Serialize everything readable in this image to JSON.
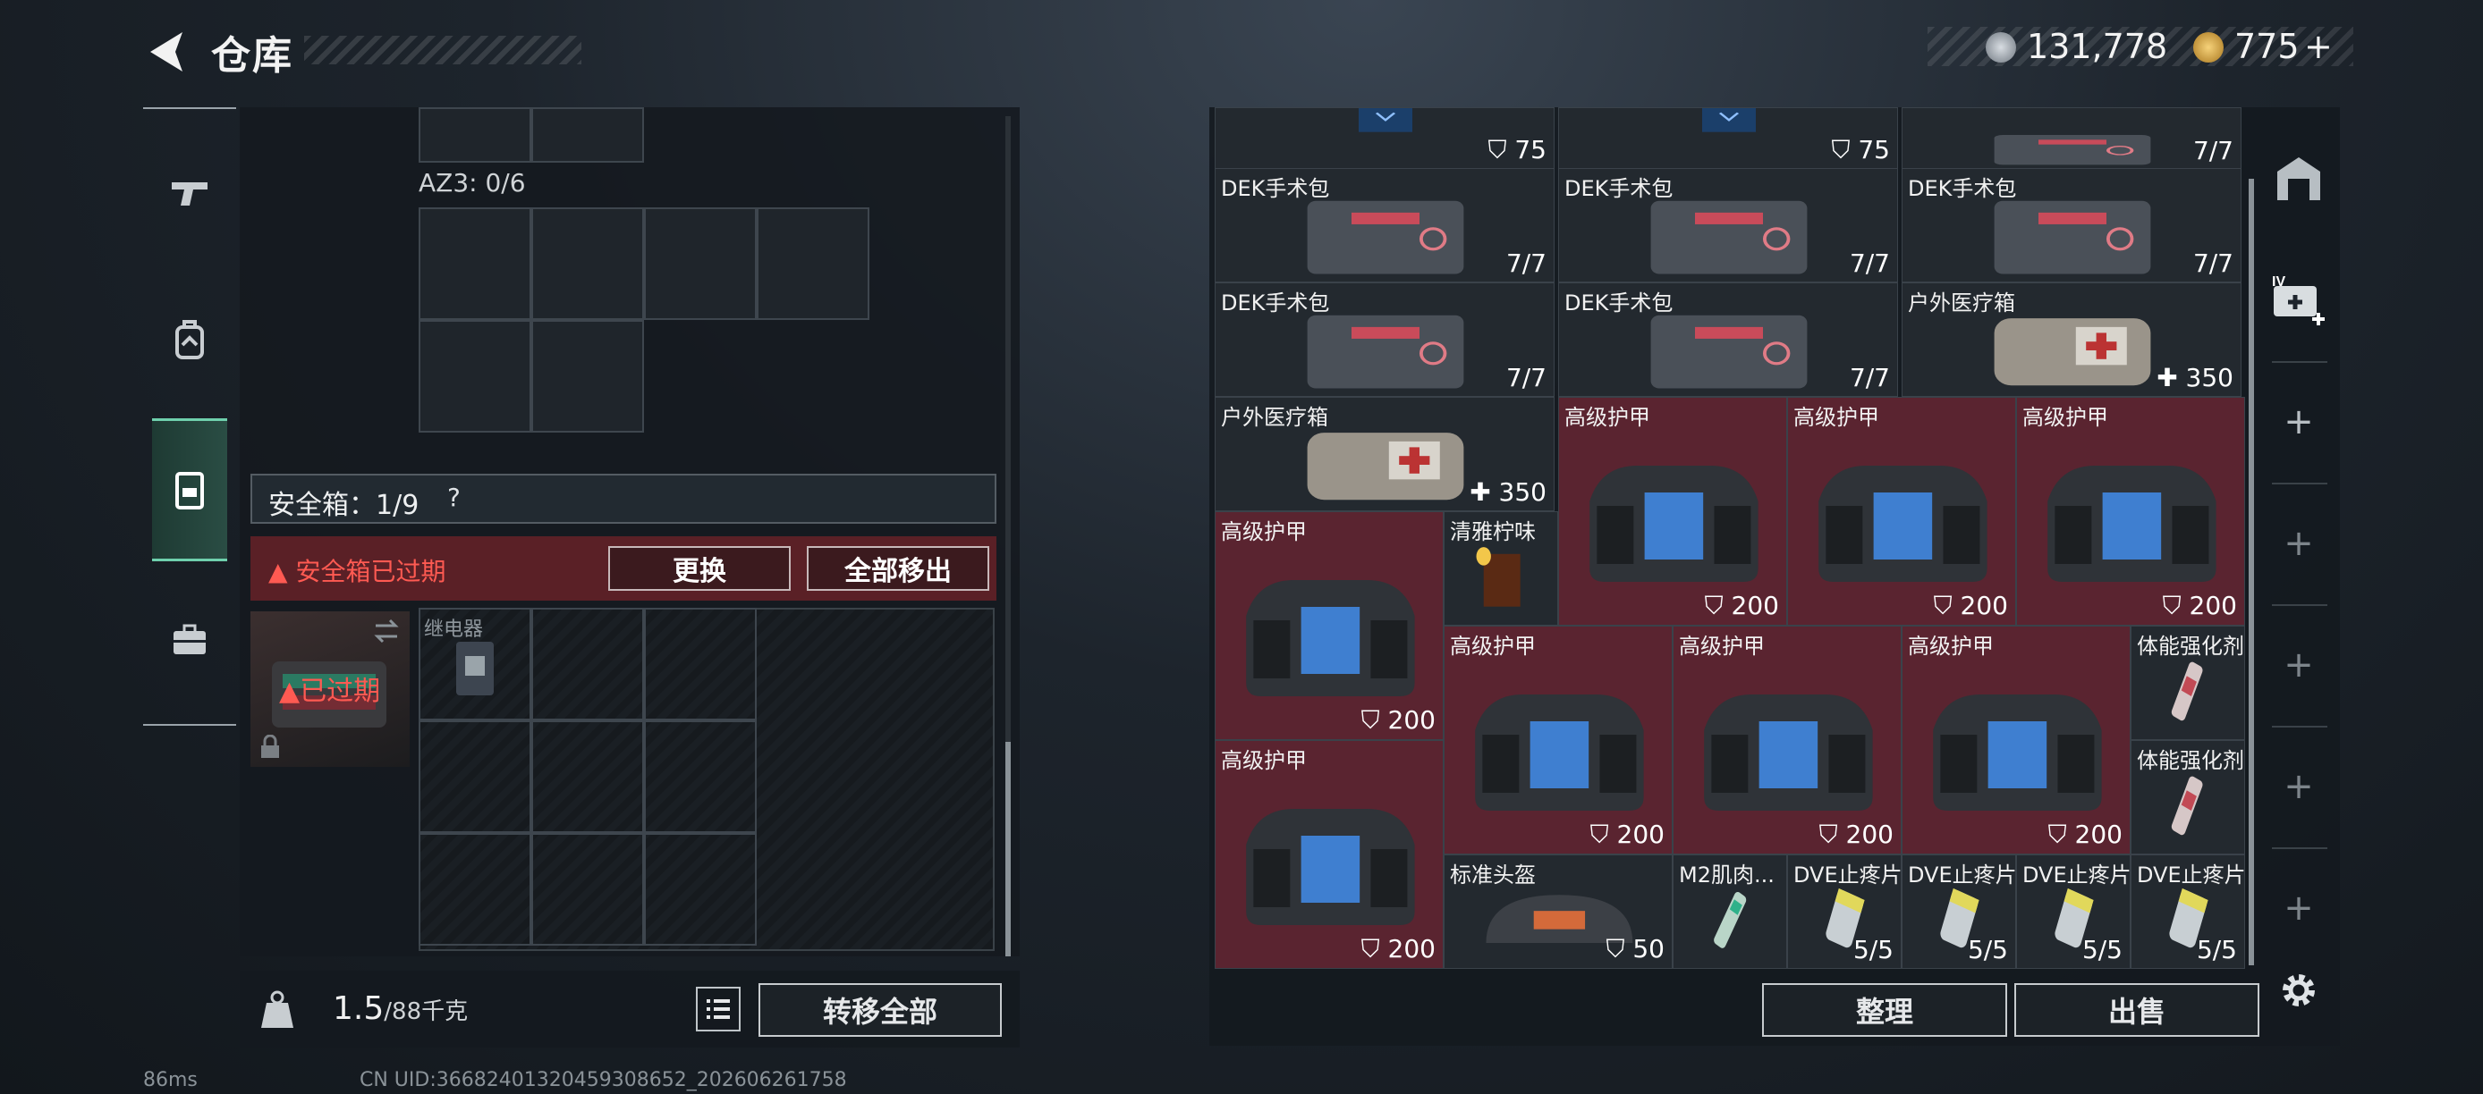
{
  "header": {
    "title": "仓库"
  },
  "currency": {
    "coins": "131,778",
    "premium": "775",
    "premium_plus": "+"
  },
  "nav": {
    "items": [
      "weapon-icon",
      "backpack-icon",
      "chest-rig-icon",
      "case-icon"
    ],
    "active": 2
  },
  "container": {
    "az3_label": "AZ3: 0/6"
  },
  "safe_box": {
    "label": "安全箱：1/9",
    "help": "?",
    "expired_warning": "安全箱已过期",
    "replace_button": "更换",
    "move_all_button": "全部移出",
    "case_expired_tag": "已过期",
    "relay_item": "继电器"
  },
  "footer": {
    "weight": "1.5",
    "weight_capacity": "/88千克",
    "transfer_all": "转移全部"
  },
  "stash": {
    "items": [
      {
        "name": "",
        "count": "75",
        "bg": "dark",
        "icon": "armor"
      },
      {
        "name": "",
        "count": "75",
        "bg": "dark",
        "icon": "armor"
      },
      {
        "name": "",
        "count": "7/7",
        "bg": "dark",
        "icon": "kit"
      },
      {
        "name": "DEK手术包",
        "count": "7/7",
        "bg": "dark",
        "icon": "kit"
      },
      {
        "name": "DEK手术包",
        "count": "7/7",
        "bg": "dark",
        "icon": "kit"
      },
      {
        "name": "DEK手术包",
        "count": "7/7",
        "bg": "dark",
        "icon": "kit"
      },
      {
        "name": "DEK手术包",
        "count": "7/7",
        "bg": "dark",
        "icon": "kit"
      },
      {
        "name": "DEK手术包",
        "count": "7/7",
        "bg": "dark",
        "icon": "kit"
      },
      {
        "name": "户外医疗箱",
        "count": "✚ 350",
        "bg": "dark",
        "icon": "medbag"
      },
      {
        "name": "户外医疗箱",
        "count": "✚ 350",
        "bg": "dark",
        "icon": "medbag"
      },
      {
        "name": "高级护甲",
        "count": "200",
        "bg": "red",
        "icon": "armorbag"
      },
      {
        "name": "高级护甲",
        "count": "200",
        "bg": "red",
        "icon": "armorbag"
      },
      {
        "name": "高级护甲",
        "count": "200",
        "bg": "red",
        "icon": "armorbag"
      },
      {
        "name": "高级护甲",
        "count": "200",
        "bg": "red",
        "icon": "armorbag"
      },
      {
        "name": "清雅柠味",
        "count": "",
        "bg": "dark",
        "icon": "drink"
      },
      {
        "name": "高级护甲",
        "count": "200",
        "bg": "red",
        "icon": "armorbag"
      },
      {
        "name": "高级护甲",
        "count": "200",
        "bg": "red",
        "icon": "armorbag"
      },
      {
        "name": "高级护甲",
        "count": "200",
        "bg": "red",
        "icon": "armorbag"
      },
      {
        "name": "体能强化剂",
        "count": "",
        "bg": "dark",
        "icon": "syringe"
      },
      {
        "name": "高级护甲",
        "count": "200",
        "bg": "red",
        "icon": "armorbag"
      },
      {
        "name": "体能强化剂",
        "count": "",
        "bg": "dark",
        "icon": "syringe"
      },
      {
        "name": "标准头盔",
        "count": "50",
        "bg": "dark",
        "icon": "helmet"
      },
      {
        "name": "M2肌肉...",
        "count": "",
        "bg": "dark",
        "icon": "injector"
      },
      {
        "name": "DVE止疼片",
        "count": "5/5",
        "bg": "dark",
        "icon": "pills"
      },
      {
        "name": "DVE止疼片",
        "count": "5/5",
        "bg": "dark",
        "icon": "pills"
      },
      {
        "name": "DVE止疼片",
        "count": "5/5",
        "bg": "dark",
        "icon": "pills"
      },
      {
        "name": "DVE止疼片",
        "count": "5/5",
        "bg": "dark",
        "icon": "pills"
      }
    ],
    "sort_button": "整理",
    "sell_button": "出售"
  },
  "rail": {
    "plus": "+",
    "icons": [
      "vendor-icon",
      "med-tab-icon",
      "settings-icon"
    ]
  },
  "status_bar": {
    "ping": "86ms",
    "uid": "CN UID:3668240132045930865​2_202606261758"
  }
}
